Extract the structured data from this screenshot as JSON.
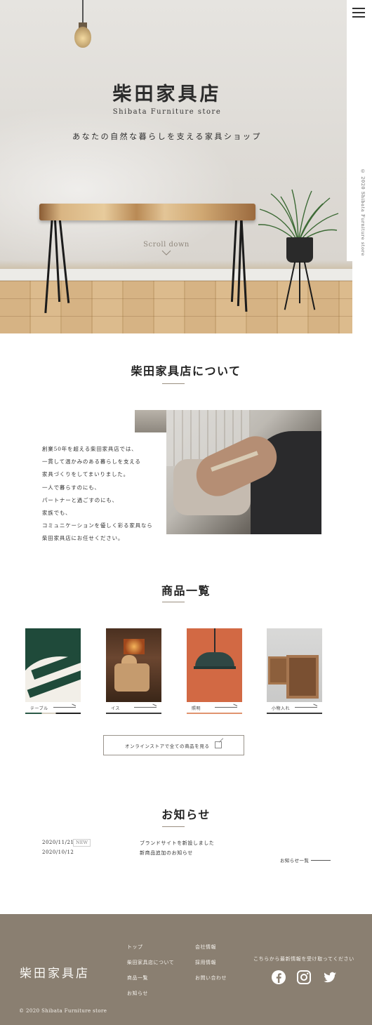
{
  "hero": {
    "title": "柴田家具店",
    "subtitle": "Shibata Furniture store",
    "tagline": "あなたの自然な暮らしを支える家具ショップ",
    "scroll_label": "Scroll down",
    "side_copyright": "© 2020 Shibata Furniture store",
    "menu_icon": "hamburger-icon"
  },
  "about": {
    "title": "柴田家具店について",
    "lines": [
      "創業50年を超える柴田家具店では、",
      "一貫して温かみのある暮らしを支える",
      "家具づくりをしてまいりました。",
      "一人で暮らすのにも、",
      "パートナーと過ごすのにも、",
      "家族でも、",
      "コミュニケーションを優しく彩る家具なら",
      "柴田家具店にお任せください。"
    ]
  },
  "products": {
    "title": "商品一覧",
    "items": [
      {
        "label": "テーブル",
        "underline_color": "#6b6b6b"
      },
      {
        "label": "イス",
        "underline_color": "#6b6b6b"
      },
      {
        "label": "照明",
        "underline_color": "#e0936f"
      },
      {
        "label": "小物入れ",
        "underline_color": "#6b6b6b"
      }
    ],
    "online_button": "オンラインストアで全ての商品を見る"
  },
  "news": {
    "title": "お知らせ",
    "items": [
      {
        "date": "2020/11/21",
        "badge": "NEW",
        "title": "ブランドサイトを新設しました"
      },
      {
        "date": "2020/10/12",
        "badge": "",
        "title": "新商品追加のお知らせ"
      }
    ],
    "more_label": "お知らせ一覧"
  },
  "footer": {
    "logo": "柴田家具店",
    "links_col1": [
      "トップ",
      "柴田家具店について",
      "商品一覧",
      "お知らせ"
    ],
    "links_col2": [
      "会社情報",
      "採用情報",
      "お問い合わせ"
    ],
    "note": "こちらから最新情報を受け取ってください",
    "social": [
      "facebook-icon",
      "instagram-icon",
      "twitter-icon"
    ],
    "copyright": "© 2020 Shibata Furniture store",
    "background": "#8a7f71"
  }
}
